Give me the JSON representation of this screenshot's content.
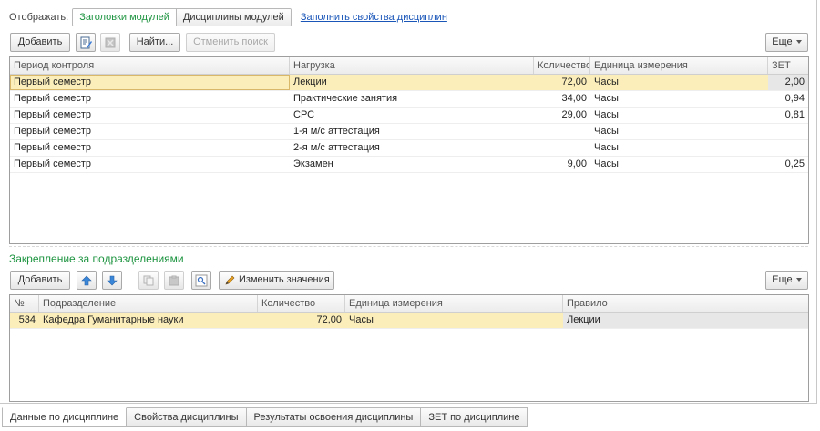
{
  "display": {
    "label": "Отображать:",
    "segments": [
      "Заголовки модулей",
      "Дисциплины модулей"
    ],
    "link": "Заполнить свойства дисциплин"
  },
  "toolbar1": {
    "add": "Добавить",
    "find": "Найти...",
    "cancel_search": "Отменить поиск",
    "more": "Еще"
  },
  "table1": {
    "headers": [
      "Период контроля",
      "Нагрузка",
      "Количество",
      "Единица измерения",
      "ЗЕТ"
    ],
    "rows": [
      [
        "Первый семестр",
        "Лекции",
        "72,00",
        "Часы",
        "2,00"
      ],
      [
        "Первый семестр",
        "Практические занятия",
        "34,00",
        "Часы",
        "0,94"
      ],
      [
        "Первый семестр",
        "СРС",
        "29,00",
        "Часы",
        "0,81"
      ],
      [
        "Первый семестр",
        "1-я м/с аттестация",
        "",
        "Часы",
        ""
      ],
      [
        "Первый семестр",
        "2-я м/с аттестация",
        "",
        "Часы",
        ""
      ],
      [
        "Первый семестр",
        "Экзамен",
        "9,00",
        "Часы",
        "0,25"
      ]
    ]
  },
  "section2": {
    "title": "Закрепление за подразделениями"
  },
  "toolbar2": {
    "add": "Добавить",
    "change_values": "Изменить значения",
    "more": "Еще"
  },
  "table2": {
    "headers": [
      "№",
      "Подразделение",
      "Количество",
      "Единица измерения",
      "Правило"
    ],
    "rows": [
      [
        "534",
        "Кафедра Гуманитарные науки",
        "72,00",
        "Часы",
        "Лекции"
      ]
    ]
  },
  "tabs": [
    "Данные по дисциплине",
    "Свойства дисциплины",
    "Результаты освоения дисциплины",
    "ЗЕТ по дисциплине"
  ],
  "colors": {
    "accent_green": "#1d9440",
    "link_blue": "#1a56b8",
    "selected_row": "#fbeebb"
  }
}
